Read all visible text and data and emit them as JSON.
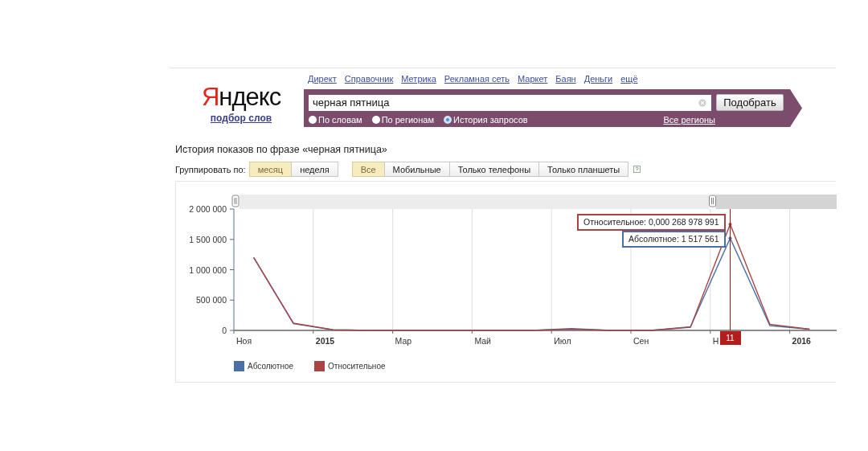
{
  "header": {
    "logo": "Яндекс",
    "logo_link": "подбор слов",
    "nav": [
      "Директ",
      "Справочник",
      "Метрика",
      "Рекламная сеть",
      "Маркет",
      "Баян",
      "Деньги",
      "ещё"
    ]
  },
  "search": {
    "value": "черная пятница",
    "button": "Подобрать",
    "modes": [
      {
        "label": "По словам",
        "selected": false
      },
      {
        "label": "По регионам",
        "selected": false
      },
      {
        "label": "История запросов",
        "selected": true
      }
    ],
    "region_link": "Все регионы"
  },
  "heading": "История показов по фразе «черная пятница»",
  "grouping": {
    "label": "Группировать по:",
    "options": [
      {
        "label": "месяц",
        "selected": true
      },
      {
        "label": "неделя",
        "selected": false
      }
    ]
  },
  "devices": {
    "options": [
      {
        "label": "Все",
        "selected": true
      },
      {
        "label": "Мобильные",
        "selected": false
      },
      {
        "label": "Только телефоны",
        "selected": false
      },
      {
        "label": "Только планшеты",
        "selected": false
      }
    ]
  },
  "chart": {
    "chart_data": {
      "type": "line",
      "categories": [
        "Ноя",
        null,
        "2015",
        null,
        "Мар",
        null,
        "Май",
        null,
        "Июл",
        null,
        "Сен",
        null,
        "Н",
        null,
        "2016"
      ],
      "series": [
        {
          "name": "Абсолютное",
          "color": "#4a6fa5",
          "values": [
            1200000,
            110000,
            10000,
            0,
            0,
            0,
            0,
            0,
            30000,
            0,
            0,
            60000,
            1520000,
            80000,
            20000
          ]
        },
        {
          "name": "Относительное",
          "color": "#a84444",
          "values": [
            1200000,
            120000,
            10000,
            0,
            0,
            0,
            0,
            0,
            20000,
            0,
            0,
            50000,
            1750000,
            100000,
            20000
          ]
        }
      ],
      "ylim": [
        0,
        2000000
      ],
      "yticks": [
        {
          "value": 0,
          "label": "0"
        },
        {
          "value": 500000,
          "label": "500 000"
        },
        {
          "value": 1000000,
          "label": "1 000 000"
        },
        {
          "value": 1500000,
          "label": "1 500 000"
        },
        {
          "value": 2000000,
          "label": "2 000 000"
        }
      ]
    },
    "cursor_label": "11",
    "tooltips": [
      {
        "color": "#a84444",
        "text": "Относительное: 0,000 268 978 991"
      },
      {
        "color": "#4a6fa5",
        "text": "Абсолютное: 1 517 561"
      }
    ]
  }
}
